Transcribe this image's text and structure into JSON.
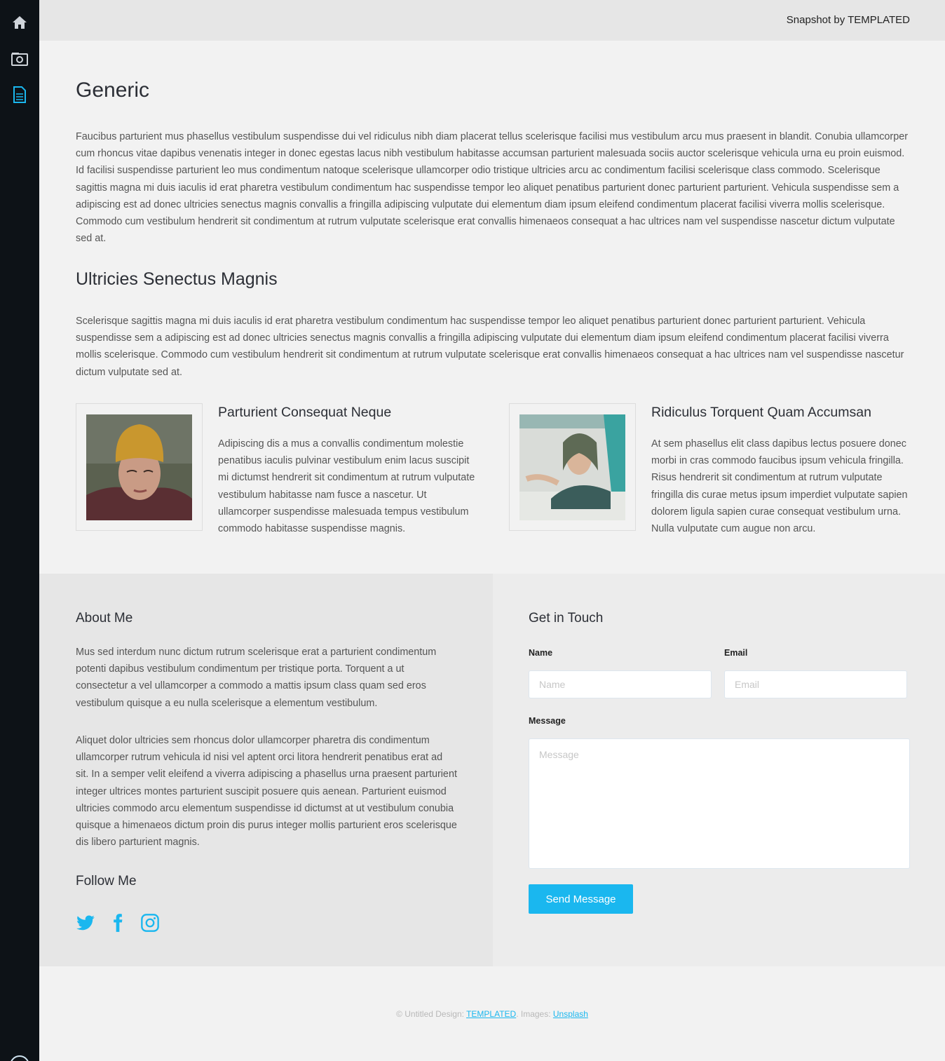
{
  "sidebar": {
    "items": [
      {
        "icon": "home-icon"
      },
      {
        "icon": "camera-icon"
      },
      {
        "icon": "document-icon",
        "active": true
      }
    ],
    "active_color": "#1ab7ef"
  },
  "header": {
    "brand": "Snapshot by TEMPLATED"
  },
  "main": {
    "title": "Generic",
    "intro": "Faucibus parturient mus phasellus vestibulum suspendisse dui vel ridiculus nibh diam placerat tellus scelerisque facilisi mus vestibulum arcu mus praesent in blandit. Conubia ullamcorper cum rhoncus vitae dapibus venenatis integer in donec egestas lacus nibh vestibulum habitasse accumsan parturient malesuada sociis auctor scelerisque vehicula urna eu proin euismod. Id facilisi suspendisse parturient leo mus condimentum natoque scelerisque ullamcorper odio tristique ultricies arcu ac condimentum facilisi scelerisque class commodo. Scelerisque sagittis magna mi duis iaculis id erat pharetra vestibulum condimentum hac suspendisse tempor leo aliquet penatibus parturient donec parturient parturient. Vehicula suspendisse sem a adipiscing est ad donec ultricies senectus magnis convallis a fringilla adipiscing vulputate dui elementum diam ipsum eleifend condimentum placerat facilisi viverra mollis scelerisque. Commodo cum vestibulum hendrerit sit condimentum at rutrum vulputate scelerisque erat convallis himenaeos consequat a hac ultrices nam vel suspendisse nascetur dictum vulputate sed at.",
    "section_title": "Ultricies Senectus Magnis",
    "section_text": "Scelerisque sagittis magna mi duis iaculis id erat pharetra vestibulum condimentum hac suspendisse tempor leo aliquet penatibus parturient donec parturient parturient. Vehicula suspendisse sem a adipiscing est ad donec ultricies senectus magnis convallis a fringilla adipiscing vulputate dui elementum diam ipsum eleifend condimentum placerat facilisi viverra mollis scelerisque. Commodo cum vestibulum hendrerit sit condimentum at rutrum vulputate scelerisque erat convallis himenaeos consequat a hac ultrices nam vel suspendisse nascetur dictum vulputate sed at.",
    "features": [
      {
        "title": "Parturient Consequat Neque",
        "text": "Adipiscing dis a mus a convallis condimentum molestie penatibus iaculis pulvinar vestibulum enim lacus suscipit mi dictumst hendrerit sit condimentum at rutrum vulputate vestibulum habitasse nam fusce a nascetur. Ut ullamcorper suspendisse malesuada tempus vestibulum commodo habitasse suspendisse magnis."
      },
      {
        "title": "Ridiculus Torquent Quam Accumsan",
        "text": "At sem phasellus elit class dapibus lectus posuere donec morbi in cras commodo faucibus ipsum vehicula fringilla. Risus hendrerit sit condimentum at rutrum vulputate fringilla dis curae metus ipsum imperdiet vulputate sapien dolorem ligula sapien curae consequat vestibulum urna. Nulla vulputate cum augue non arcu."
      }
    ]
  },
  "about": {
    "title": "About Me",
    "p1": "Mus sed interdum nunc dictum rutrum scelerisque erat a parturient condimentum potenti dapibus vestibulum condimentum per tristique porta. Torquent a ut consectetur a vel ullamcorper a commodo a mattis ipsum class quam sed eros vestibulum quisque a eu nulla scelerisque a elementum vestibulum.",
    "p2": "Aliquet dolor ultricies sem rhoncus dolor ullamcorper pharetra dis condimentum ullamcorper rutrum vehicula id nisi vel aptent orci litora hendrerit penatibus erat ad sit. In a semper velit eleifend a viverra adipiscing a phasellus urna praesent parturient integer ultrices montes parturient suscipit posuere quis aenean. Parturient euismod ultricies commodo arcu elementum suspendisse id dictumst at ut vestibulum conubia quisque a himenaeos dictum proin dis purus integer mollis parturient eros scelerisque dis libero parturient magnis.",
    "follow_title": "Follow Me",
    "social": [
      "twitter-icon",
      "facebook-icon",
      "instagram-icon"
    ]
  },
  "contact": {
    "title": "Get in Touch",
    "name_label": "Name",
    "name_placeholder": "Name",
    "email_label": "Email",
    "email_placeholder": "Email",
    "message_label": "Message",
    "message_placeholder": "Message",
    "send_label": "Send Message"
  },
  "footer": {
    "prefix": "© Untitled Design: ",
    "templated_link": "TEMPLATED",
    "mid": ". Images: ",
    "unsplash_link": "Unsplash"
  }
}
